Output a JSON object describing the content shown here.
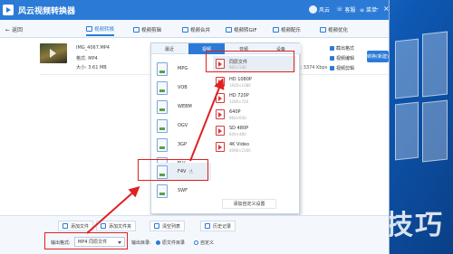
{
  "app": {
    "title": "风云视频转换器",
    "user": "风云",
    "messages": "客服",
    "menu": "菜单",
    "back": "返回",
    "tabs": [
      {
        "label": "视频转换",
        "active": true
      },
      {
        "label": "视频剪辑",
        "active": false
      },
      {
        "label": "视频合并",
        "active": false
      },
      {
        "label": "视频转GIF",
        "active": false
      },
      {
        "label": "视频配乐",
        "active": false
      },
      {
        "label": "视频优化",
        "active": false
      }
    ]
  },
  "file": {
    "name": "IMG_4067.MP4",
    "format": "格式: MP4",
    "size": "大小: 3.61 MB",
    "right_info": "C: 3374 Kbps",
    "options": [
      "截出格式",
      "视频编辑",
      "视频剪辑"
    ],
    "convert_label": "转换(新建)"
  },
  "popup": {
    "tabs": [
      "最近",
      "视频",
      "音频",
      "设备"
    ],
    "formats": [
      "MPG",
      "VOB",
      "WEBM",
      "OGV",
      "3GP",
      "FLV",
      "F4V",
      "SWF"
    ],
    "selected_format": "F4V",
    "presets": [
      {
        "name": "同原文件",
        "spec": "960×540"
      },
      {
        "name": "HD 1080P",
        "spec": "1920×1080"
      },
      {
        "name": "HD 720P",
        "spec": "1280×720"
      },
      {
        "name": "640P",
        "spec": "960×640"
      },
      {
        "name": "SD 480P",
        "spec": "640×480"
      },
      {
        "name": "4K Video",
        "spec": "4096×2160"
      }
    ],
    "custom_label": "添加自定义设置"
  },
  "bottom": {
    "buttons": [
      "添加文件",
      "添加文件夹",
      "清空列表",
      "历史记录"
    ],
    "output_format_label": "输出格式:",
    "output_format_value": "MP4 同原文件",
    "output_dir_label": "输出目录:",
    "radio_source": "原文件目录",
    "radio_custom": "自定义"
  },
  "watermark": "软件技巧",
  "colors": {
    "accent": "#2b7bd6",
    "highlight": "#e02020"
  }
}
